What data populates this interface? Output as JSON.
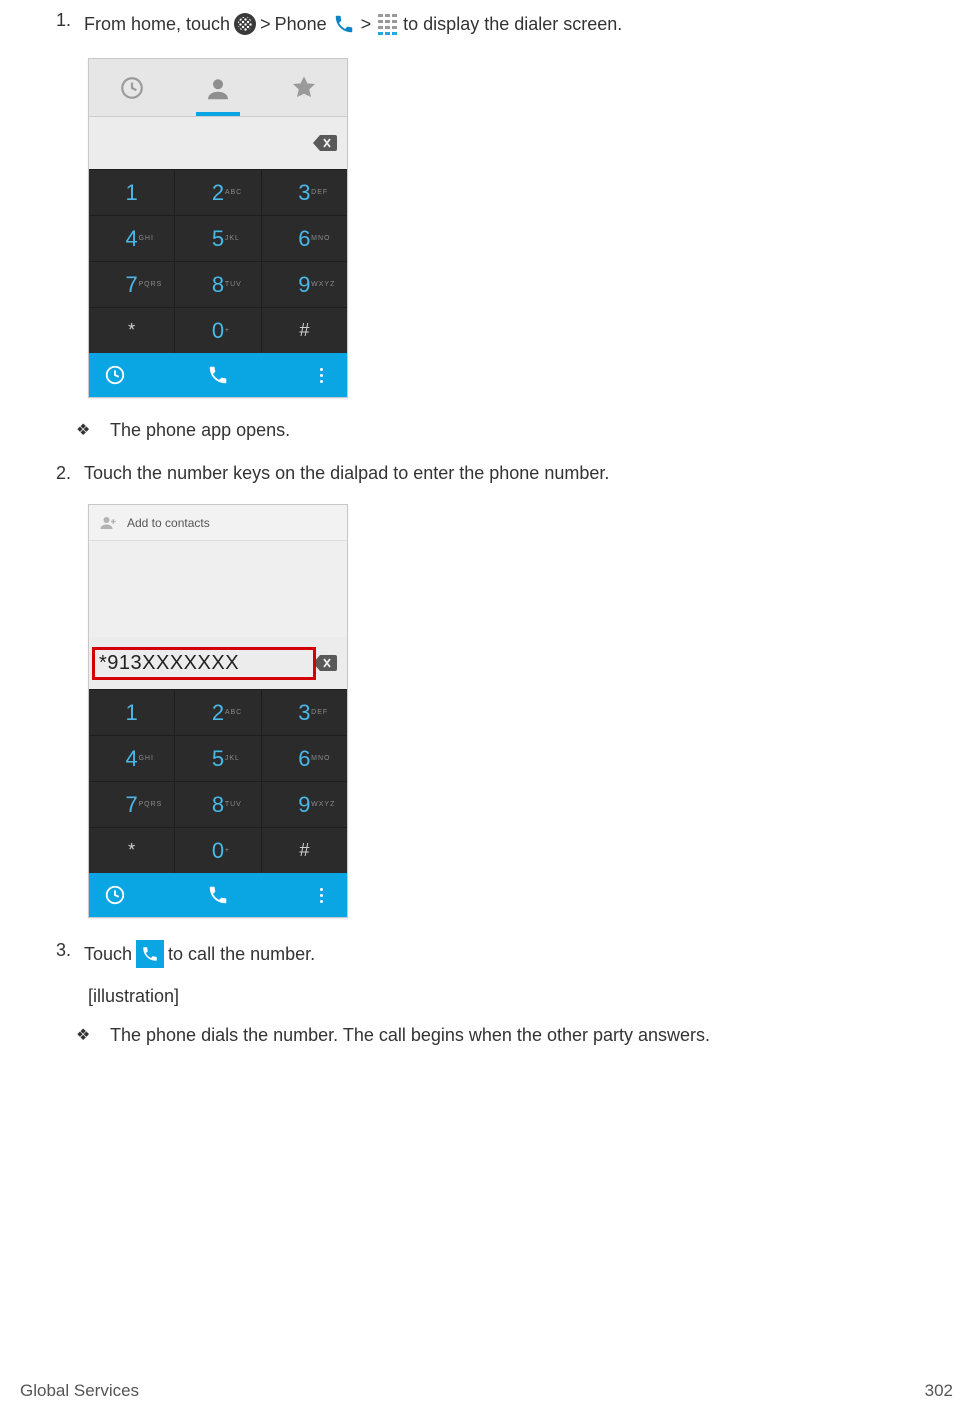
{
  "steps": {
    "s1": {
      "num": "1.",
      "p1": "From home, touch",
      "sep1": ">",
      "phone_word": "Phone",
      "sep2": ">",
      "p2": "to display the dialer screen."
    },
    "s1_result": "The phone app opens.",
    "s2": {
      "num": "2.",
      "text": "Touch the number keys on the dialpad to enter the phone number."
    },
    "s3": {
      "num": "3.",
      "p1": "Touch",
      "p2": "to call the number."
    },
    "s3_illus": "[illustration]",
    "s3_result": "The phone dials the number. The call begins when the other party answers."
  },
  "dialpad": {
    "add_contacts": "Add to contacts",
    "entered_number": "*913XXXXXXX",
    "keys": {
      "k1": "1",
      "k1l": "",
      "k2": "2",
      "k2l": "ABC",
      "k3": "3",
      "k3l": "DEF",
      "k4": "4",
      "k4l": "GHI",
      "k5": "5",
      "k5l": "JKL",
      "k6": "6",
      "k6l": "MNO",
      "k7": "7",
      "k7l": "PQRS",
      "k8": "8",
      "k8l": "TUV",
      "k9": "9",
      "k9l": "WXYZ",
      "kstar": "*",
      "k0": "0",
      "k0l": "+",
      "khash": "#"
    }
  },
  "footer": {
    "left": "Global Services",
    "right": "302"
  }
}
